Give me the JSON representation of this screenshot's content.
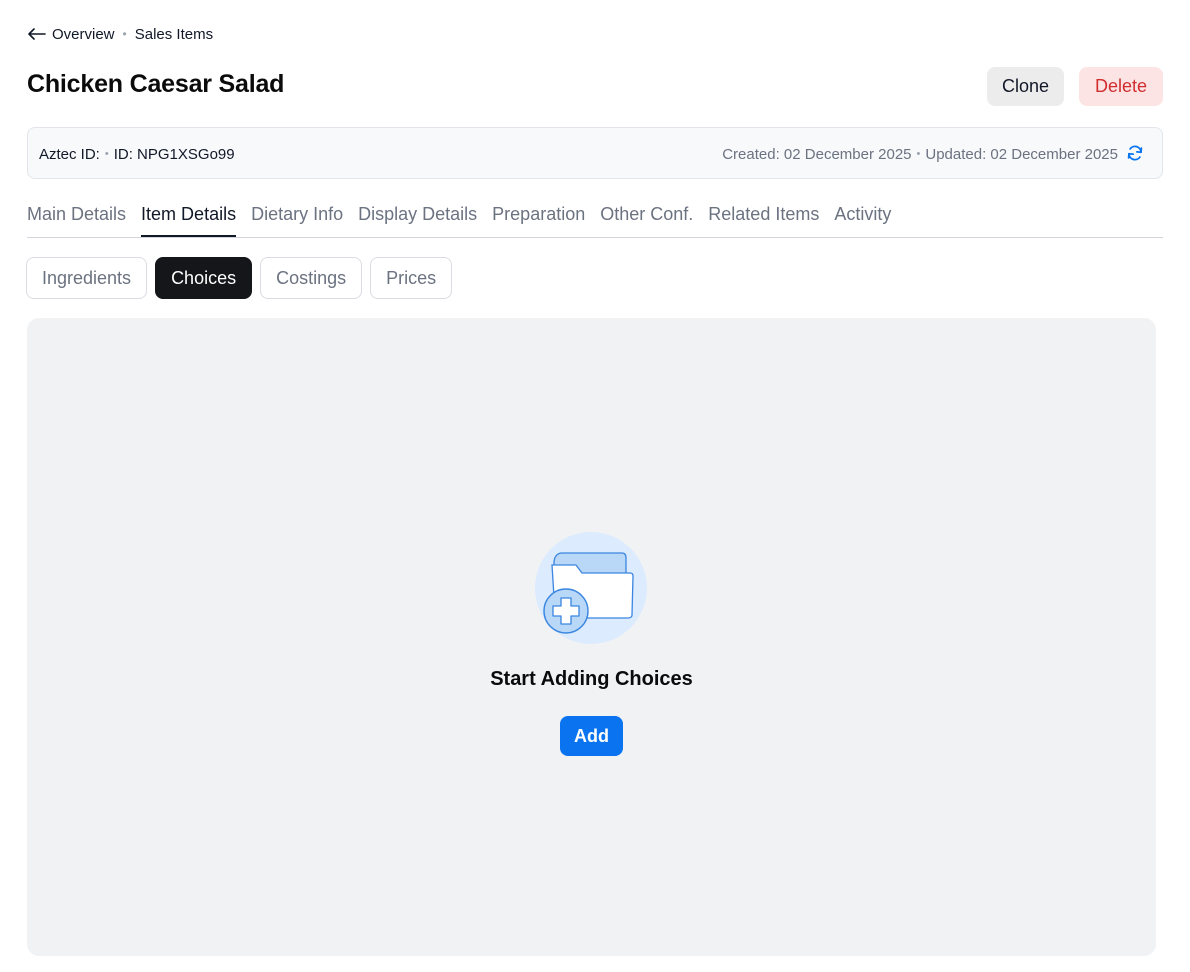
{
  "breadcrumb": {
    "back_label": "Overview",
    "current": "Sales Items"
  },
  "page": {
    "title": "Chicken Caesar Salad"
  },
  "actions": {
    "clone_label": "Clone",
    "delete_label": "Delete"
  },
  "info": {
    "aztec_id_label": "Aztec ID:",
    "id_label": "ID: NPG1XSGo99",
    "created": "Created: 02 December 2025",
    "updated": "Updated: 02 December 2025"
  },
  "tabs": [
    {
      "label": "Main Details"
    },
    {
      "label": "Item Details",
      "active": true
    },
    {
      "label": "Dietary Info"
    },
    {
      "label": "Display Details"
    },
    {
      "label": "Preparation"
    },
    {
      "label": "Other Conf."
    },
    {
      "label": "Related Items"
    },
    {
      "label": "Activity"
    }
  ],
  "subtabs": [
    {
      "label": "Ingredients"
    },
    {
      "label": "Choices",
      "active": true
    },
    {
      "label": "Costings"
    },
    {
      "label": "Prices"
    }
  ],
  "empty_state": {
    "title": "Start Adding Choices",
    "add_label": "Add",
    "icon": "folder-add-icon"
  },
  "colors": {
    "primary": "#0a74f0",
    "danger_text": "#d02e2e",
    "danger_bg": "#fde4e4",
    "active_subtab_bg": "#141619",
    "panel_bg": "#f1f2f4"
  }
}
